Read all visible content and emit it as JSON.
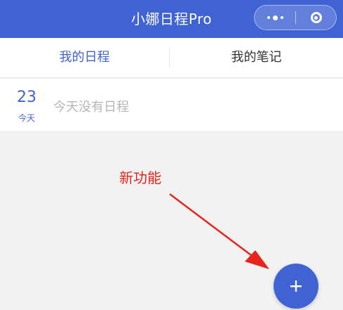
{
  "app": {
    "title": "小娜日程Pro",
    "accent_color": "#3f63d3",
    "capsule": {
      "more_icon": "more-dots-icon",
      "close_icon": "target-circle-icon"
    }
  },
  "tabs": [
    {
      "label": "我的日程",
      "active": true
    },
    {
      "label": "我的笔记",
      "active": false
    }
  ],
  "schedule": {
    "day_number": "23",
    "day_label": "今天",
    "empty_text": "今天没有日程"
  },
  "annotation": {
    "text": "新功能",
    "color": "#e8231c"
  },
  "fab": {
    "icon": "plus-icon"
  }
}
